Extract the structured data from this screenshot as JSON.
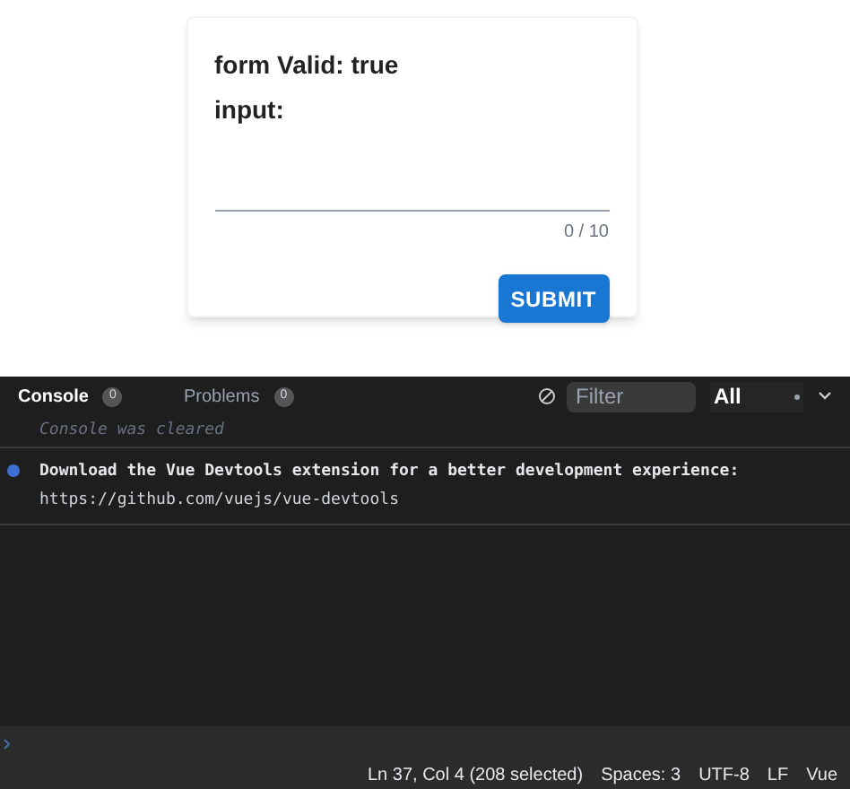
{
  "form": {
    "lines": [
      "form Valid: true",
      "input:"
    ],
    "field": {
      "counter": "0 / 10"
    },
    "submit": "SUBMIT"
  },
  "console": {
    "tabs": [
      {
        "label": "Console",
        "count": "0",
        "selected": true
      },
      {
        "label": "Problems",
        "count": "0",
        "selected": false
      }
    ],
    "filter": {
      "placeholder": "Filter"
    },
    "level_select": "All",
    "messages": [
      {
        "kind": "cleared",
        "text": "Console was cleared"
      },
      {
        "kind": "info",
        "text": "Download the Vue Devtools extension for a better development experience:",
        "link": "https://github.com/vuejs/vue-devtools"
      }
    ]
  },
  "status_bar": [
    "Ln 37, Col 4 (208 selected)",
    "Spaces: 3",
    "UTF-8",
    "LF",
    "Vue"
  ]
}
